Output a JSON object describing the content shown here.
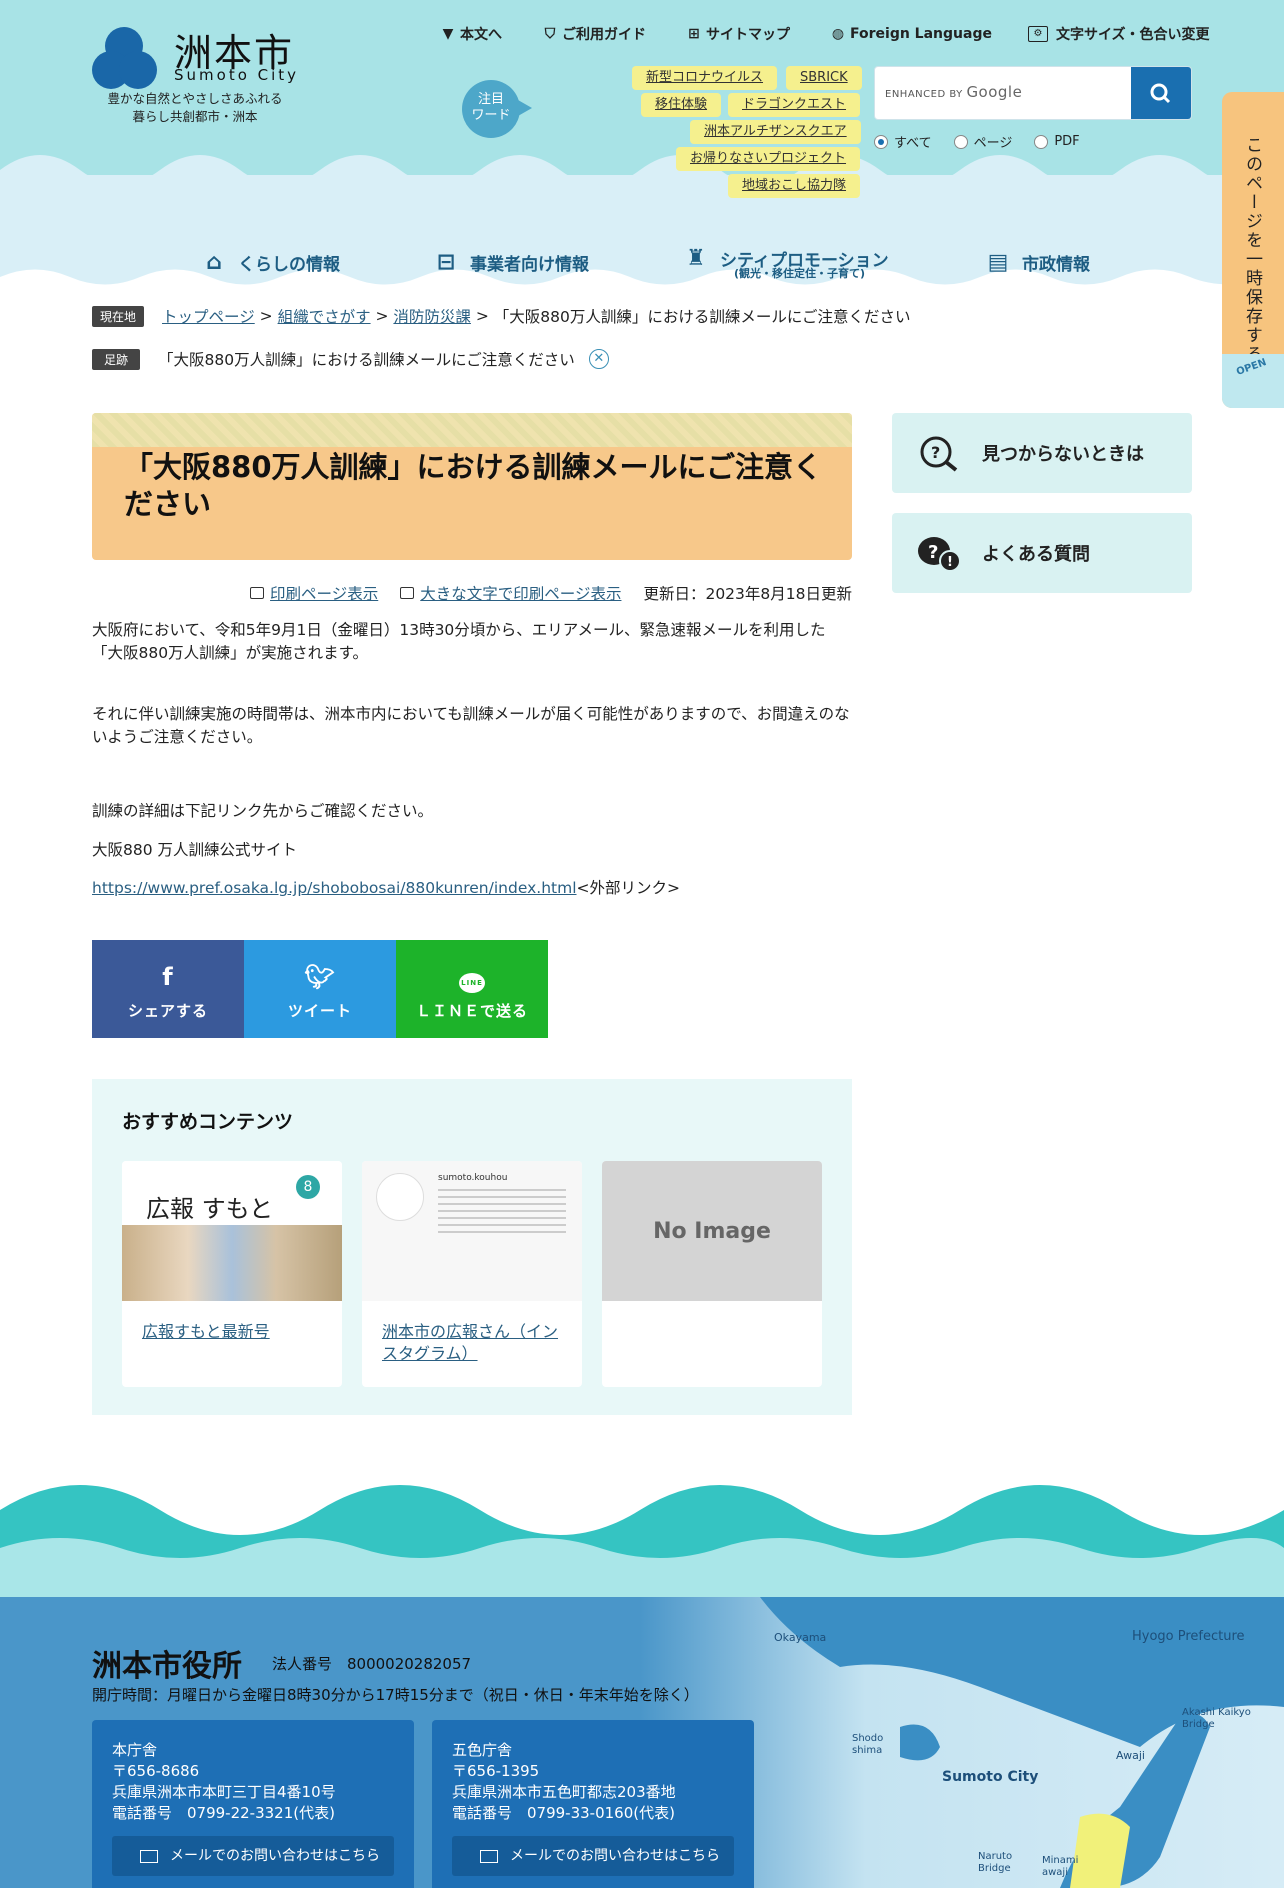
{
  "header": {
    "logo_name": "洲本市",
    "logo_en": "Sumoto City",
    "logo_caption_1": "豊かな自然とやさしさあふれる",
    "logo_caption_2": "暮らし共創都市・洲本",
    "top_links": [
      "本文へ",
      "ご利用ガイド",
      "サイトマップ",
      "Foreign Language",
      "文字サイズ・色合い変更"
    ],
    "top_link_icons": [
      "skip-icon",
      "guide-icon",
      "sitemap-icon",
      "globe-icon",
      "text-size-icon"
    ],
    "bubble_1": "注目",
    "bubble_2": "ワード",
    "tags": [
      "新型コロナウイルス",
      "SBRICK",
      "移住体験",
      "ドラゴンクエスト",
      "洲本アルチザンスクエア",
      "お帰りなさいプロジェクト",
      "地域おこし協力隊"
    ],
    "search_enhanced": "ENHANCED BY",
    "search_google": "Google",
    "search_options": [
      "すべて",
      "ページ",
      "PDF"
    ],
    "search_selected": "すべて"
  },
  "global_nav": {
    "items": [
      "くらしの情報",
      "事業者向け情報",
      "シティプロモーション",
      "市政情報"
    ],
    "promo_sub": "(観光・移住定住・子育て)"
  },
  "side_tab": {
    "label": "このページを一時保存する",
    "open": "OPEN"
  },
  "breadcrumb": {
    "label": "現在地",
    "links": [
      "トップページ",
      "組織でさがす",
      "消防防災課"
    ],
    "current": "「大阪880万人訓練」における訓練メールにご注意ください"
  },
  "footprint": {
    "label": "足跡",
    "item": "「大阪880万人訓練」における訓練メールにご注意ください"
  },
  "article": {
    "title": "「大阪880万人訓練」における訓練メールにご注意ください",
    "print_link": "印刷ページ表示",
    "print_large_link": "大きな文字で印刷ページ表示",
    "updated": "更新日：2023年8月18日更新",
    "p1": "大阪府において、令和5年9月1日（金曜日）13時30分頃から、エリアメール、緊急速報メールを利用した「大阪880万人訓練」が実施されます。",
    "p2": "それに伴い訓練実施の時間帯は、洲本市内においても訓練メールが届く可能性がありますので、お間違えのないようご注意ください。",
    "p3": "訓練の詳細は下記リンク先からご確認ください。",
    "p4": "大阪880 万人訓練公式サイト",
    "url": "https://www.pref.osaka.lg.jp/shobobosai/880kunren/index.html",
    "external": "<外部リンク>"
  },
  "share": {
    "facebook": "シェアする",
    "twitter": "ツイート",
    "line": "ＬＩＮＥで送る",
    "colors": {
      "facebook": "#3b5998",
      "twitter": "#2c9ae0",
      "line": "#1db32a"
    }
  },
  "recommend": {
    "title": "おすすめコンテンツ",
    "cards": [
      {
        "caption": "広報すもと最新号",
        "image_text": "広報 すもと",
        "badge": "8"
      },
      {
        "caption": "洲本市の広報さん（インスタグラム）",
        "image_text": "sumoto.kouhou"
      },
      {
        "caption": "",
        "image_text": "No Image"
      }
    ]
  },
  "sidebar": {
    "buttons": [
      "見つからないときは",
      "よくある質問"
    ]
  },
  "footer": {
    "name": "洲本市役所",
    "corp_number": "法人番号　8000020282057",
    "hours": "開庁時間：月曜日から金曜日8時30分から17時15分まで（祝日・休日・年末年始を除く）",
    "offices": [
      {
        "name": "本庁舎",
        "zip": "〒656-8686",
        "address": "兵庫県洲本市本町三丁目4番10号",
        "tel": "電話番号　0799-22-3321(代表)",
        "mail": "メールでのお問い合わせはこちら"
      },
      {
        "name": "五色庁舎",
        "zip": "〒656-1395",
        "address": "兵庫県洲本市五色町都志203番地",
        "tel": "電話番号　0799-33-0160(代表)",
        "mail": "メールでのお問い合わせはこちら"
      }
    ],
    "map_labels": [
      "Okayama",
      "Hyogo Prefecture",
      "Akashi Kaikyo Bridge",
      "Shodo shima",
      "Awaji",
      "Sumoto City",
      "Naruto Bridge",
      "Minami awaji"
    ]
  }
}
